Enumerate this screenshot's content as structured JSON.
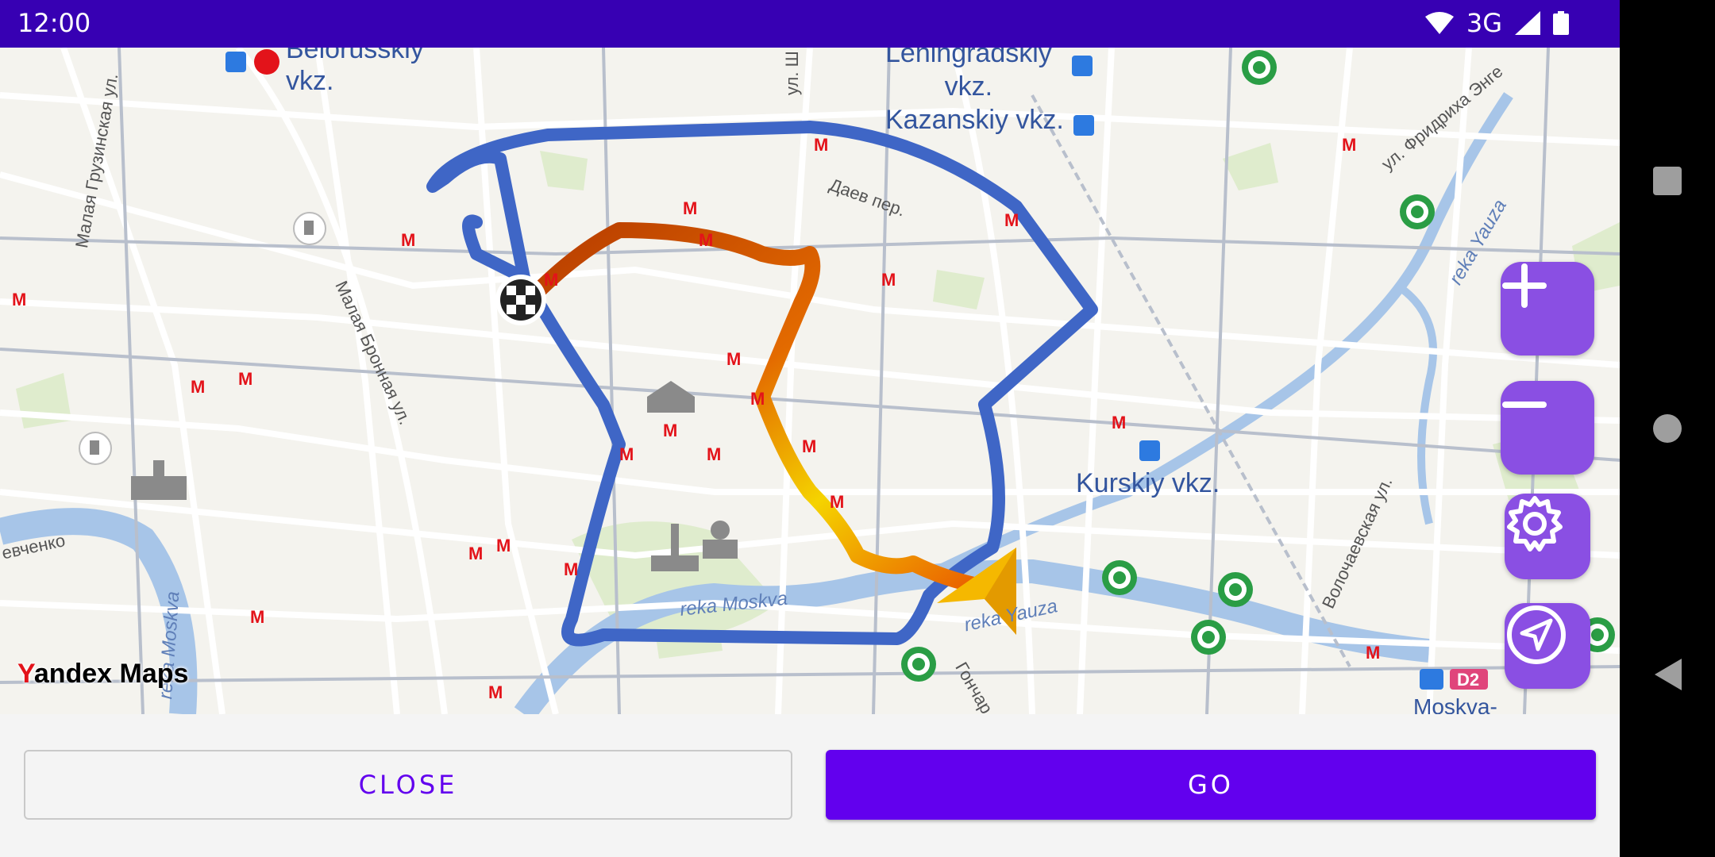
{
  "status_bar": {
    "time": "12:00",
    "network": "3G"
  },
  "map": {
    "stations": [
      {
        "label": "Belorusskiy\nvkz."
      },
      {
        "label": "Leningradskiy\nvkz."
      },
      {
        "label": "Kazanskiy vkz."
      },
      {
        "label": "Kurskiy vkz."
      },
      {
        "label": "Moskva-"
      }
    ],
    "streets": [
      "Малая Грузинская ул.",
      "Малая Бронная ул.",
      "Даев пер.",
      "ул. Фридриха Энге",
      "Волочаевская ул.",
      "ул. Ш",
      "Гончар",
      "евченко"
    ],
    "rivers": [
      "reka Moskva",
      "reka Yauza",
      "reka Yauza",
      "reka Moskva"
    ],
    "badge": "D2",
    "logo": {
      "y": "Y",
      "rest": "andex Maps"
    }
  },
  "controls": {
    "zoom_in": "zoom-in-icon",
    "zoom_out": "zoom-out-icon",
    "settings": "gear-icon",
    "locate": "navigation-arrow-icon"
  },
  "actions": {
    "close_label": "CLOSE",
    "go_label": "GO"
  },
  "colors": {
    "status_bar": "#3700b3",
    "accent": "#6200ee",
    "fab": "#8a4fe3",
    "route_alt": "#3f66c6",
    "route_main_start": "#b53a00",
    "route_main_end": "#f5d300"
  }
}
